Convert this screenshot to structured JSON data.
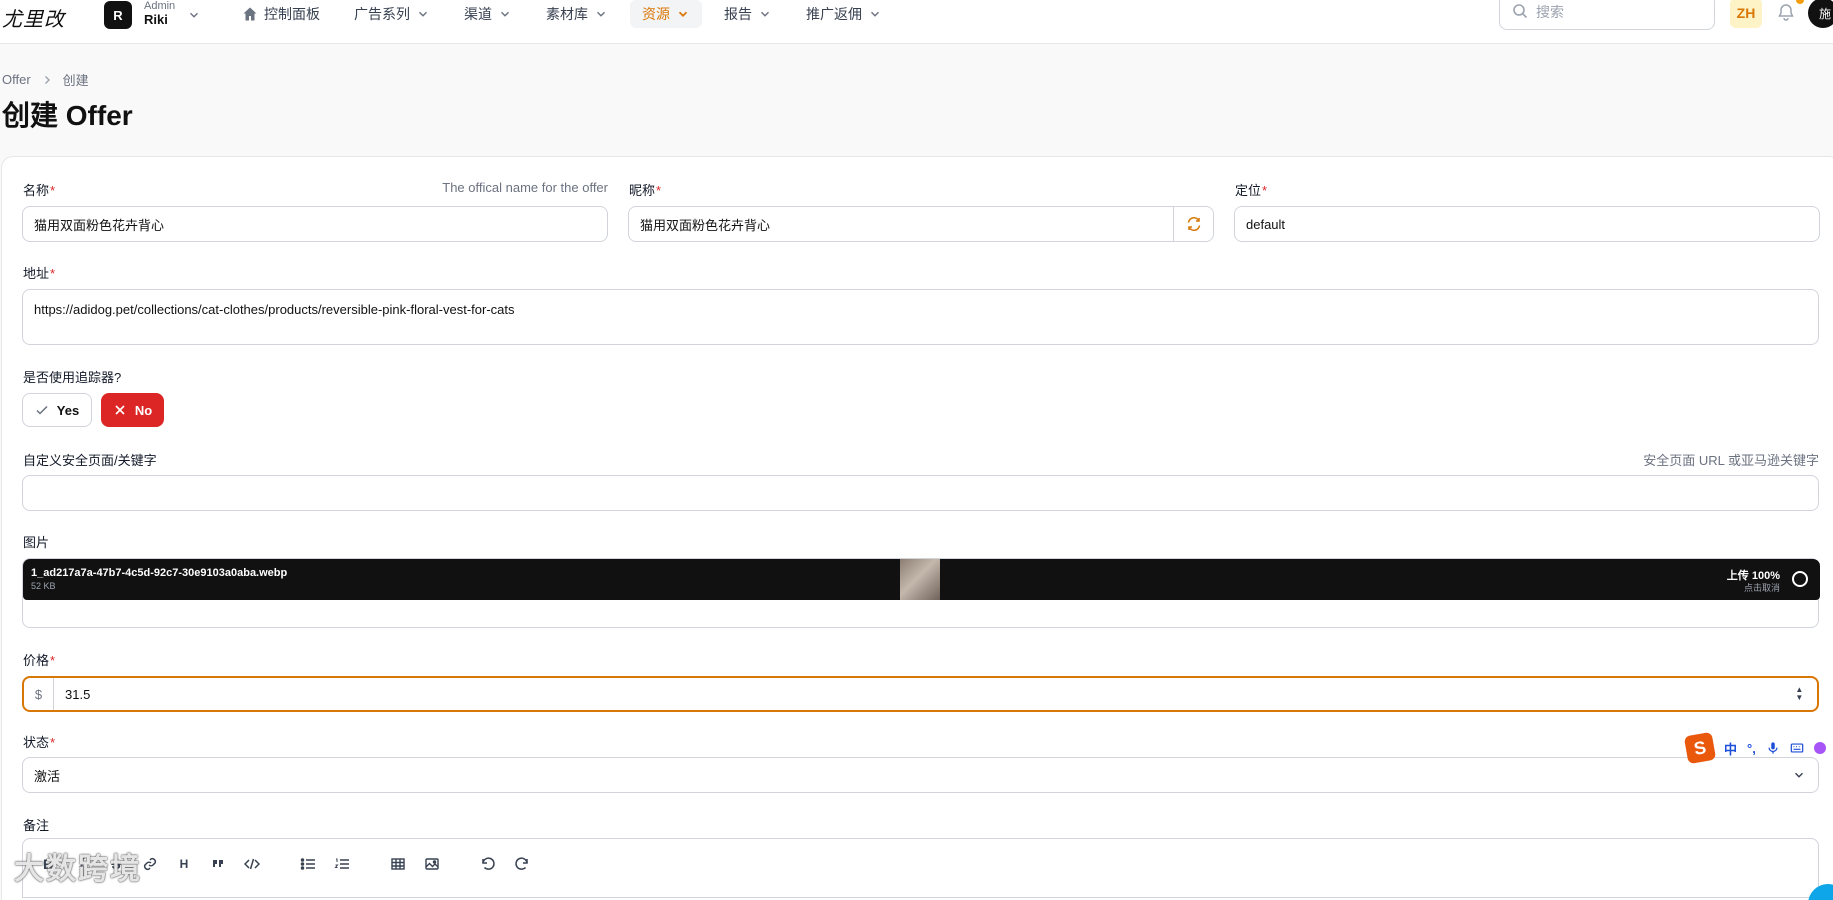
{
  "header": {
    "logo": "尤里改",
    "tenant": {
      "initial": "R",
      "role": "Admin",
      "name": "Riki"
    },
    "nav": [
      {
        "label": "控制面板",
        "has_home_icon": true,
        "has_chevron": false,
        "active": false
      },
      {
        "label": "广告系列",
        "has_home_icon": false,
        "has_chevron": true,
        "active": false
      },
      {
        "label": "渠道",
        "has_home_icon": false,
        "has_chevron": true,
        "active": false
      },
      {
        "label": "素材库",
        "has_home_icon": false,
        "has_chevron": true,
        "active": false
      },
      {
        "label": "资源",
        "has_home_icon": false,
        "has_chevron": true,
        "active": true
      },
      {
        "label": "报告",
        "has_home_icon": false,
        "has_chevron": true,
        "active": false
      },
      {
        "label": "推广返佣",
        "has_home_icon": false,
        "has_chevron": true,
        "active": false
      }
    ],
    "search_placeholder": "搜索",
    "language": "ZH",
    "user_avatar": "施",
    "accent_color": "#d97706"
  },
  "page": {
    "breadcrumb": [
      "Offer",
      "创建"
    ],
    "title": "创建 Offer"
  },
  "form": {
    "name": {
      "label": "名称",
      "hint": "The offical name for the offer",
      "value": "猫用双面粉色花卉背心"
    },
    "nickname": {
      "label": "昵称",
      "value": "猫用双面粉色花卉背心"
    },
    "position": {
      "label": "定位",
      "value": "default"
    },
    "url": {
      "label": "地址",
      "value": "https://adidog.pet/collections/cat-clothes/products/reversible-pink-floral-vest-for-cats"
    },
    "tracker": {
      "label": "是否使用追踪器?",
      "yes_label": "Yes",
      "no_label": "No",
      "selected": "No"
    },
    "safe_page": {
      "label": "自定义安全页面/关键字",
      "hint": "安全页面 URL 或亚马逊关键字",
      "value": ""
    },
    "image": {
      "label": "图片",
      "file_name": "1_ad217a7a-47b7-4c5d-92c7-30e9103a0aba.webp",
      "file_size": "52 KB",
      "status": "上传 100%",
      "status_sub": "点击取消"
    },
    "price": {
      "label": "价格",
      "prefix": "$",
      "value": "31.5"
    },
    "status": {
      "label": "状态",
      "value": "激活"
    },
    "notes": {
      "label": "备注"
    },
    "required_mark": "*"
  },
  "ime": {
    "lang": "中",
    "punct": "°,"
  },
  "watermark": "大数跨境"
}
